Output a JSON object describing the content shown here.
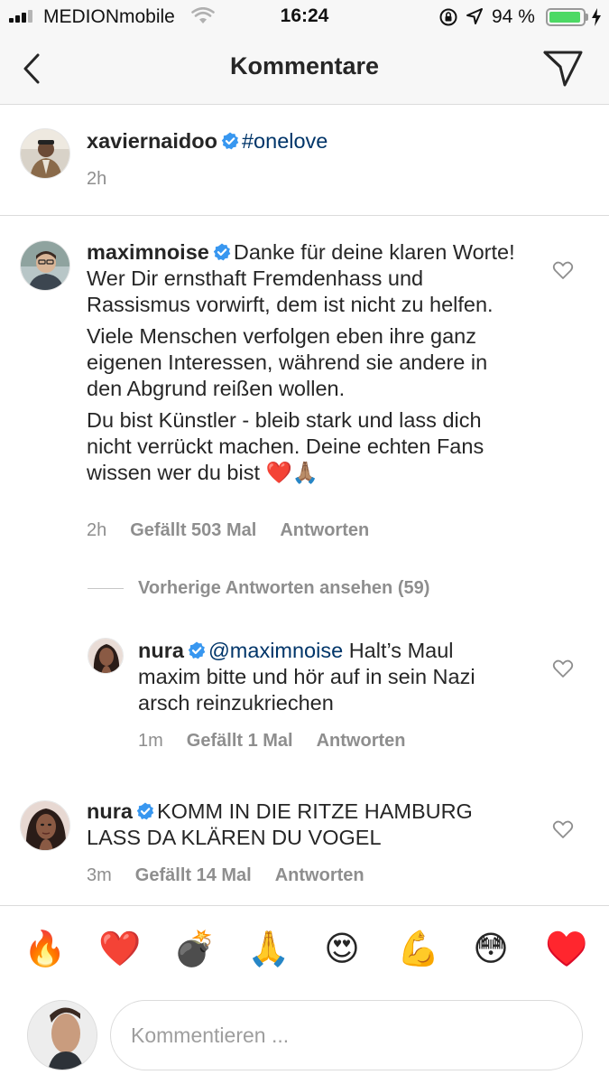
{
  "status_bar": {
    "carrier": "MEDIONmobile",
    "time": "16:24",
    "battery_percent": "94 %",
    "battery_level": 0.94,
    "battery_color": "#4cd964",
    "icons": [
      "signal-icon",
      "wifi-icon",
      "rotation-lock-icon",
      "location-icon",
      "battery-icon",
      "charging-icon"
    ]
  },
  "nav": {
    "title": "Kommentare",
    "back_icon": "chevron-left-icon",
    "send_icon": "paper-plane-icon"
  },
  "caption": {
    "username": "xaviernaidoo",
    "verified": true,
    "text": "#onelove",
    "time": "2h"
  },
  "comments": [
    {
      "username": "maximnoise",
      "verified": true,
      "paragraphs": [
        "Danke für deine klaren Worte! Wer Dir ernsthaft Fremdenhass und Rassismus vorwirft, dem ist nicht zu helfen.",
        "Viele Menschen verfolgen eben ihre ganz eigenen Interessen, während sie andere in den Abgrund reißen wollen.",
        "Du bist Künstler - bleib stark und lass dich nicht verrückt machen. Deine echten Fans wissen wer du bist ❤️🙏🏽"
      ],
      "time": "2h",
      "likes": "Gefällt 503 Mal",
      "reply_label": "Antworten",
      "view_previous_replies": "Vorherige Antworten ansehen (59)",
      "replies": [
        {
          "username": "nura",
          "verified": true,
          "mention": "@maximnoise",
          "text": "Halt’s Maul maxim bitte und hör auf in sein Nazi arsch reinzukriechen",
          "time": "1m",
          "likes": "Gefällt 1 Mal",
          "reply_label": "Antworten"
        }
      ]
    },
    {
      "username": "nura",
      "verified": true,
      "paragraphs": [
        "KOMM IN DIE RITZE HAMBURG LASS DA KLÄREN DU VOGEL"
      ],
      "time": "3m",
      "likes": "Gefällt 14 Mal",
      "reply_label": "Antworten"
    }
  ],
  "emoji_bar": [
    "🔥",
    "❤️",
    "💣",
    "🙏",
    "😍",
    "💪",
    "😳",
    "♥️"
  ],
  "composer": {
    "placeholder": "Kommentieren ..."
  },
  "colors": {
    "verified_badge": "#3897f0",
    "link": "#003569",
    "meta_text": "#8e8e8e",
    "bar_background": "#f7f7f7",
    "divider": "#dbdbdb"
  }
}
